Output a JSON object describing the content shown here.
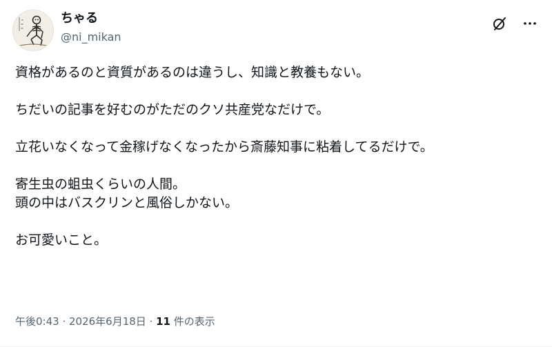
{
  "author": {
    "display_name": "ちゃる",
    "handle": "@ni_mikan"
  },
  "icons": {
    "grok": "grok-icon",
    "more": "more-icon",
    "avatar": "skeleton-avatar"
  },
  "tweet": {
    "lines": [
      "資格があるのと資質があるのは違うし、知識と教養もない。",
      "ちだいの記事を好むのがただのクソ共産党なだけで。",
      "立花いなくなって金稼げなくなったから斎藤知事に粘着してるだけで。",
      "寄生虫の蛆虫くらいの人間。",
      "頭の中はバスクリンと風俗しかない。",
      "お可愛いこと。"
    ]
  },
  "meta": {
    "time": "午後0:43",
    "separator1": " · ",
    "date": "2026年6月18日",
    "separator2": " · ",
    "views_count": "11",
    "views_label": " 件の表示"
  },
  "colors": {
    "text": "#0f1419",
    "secondary": "#536471"
  }
}
